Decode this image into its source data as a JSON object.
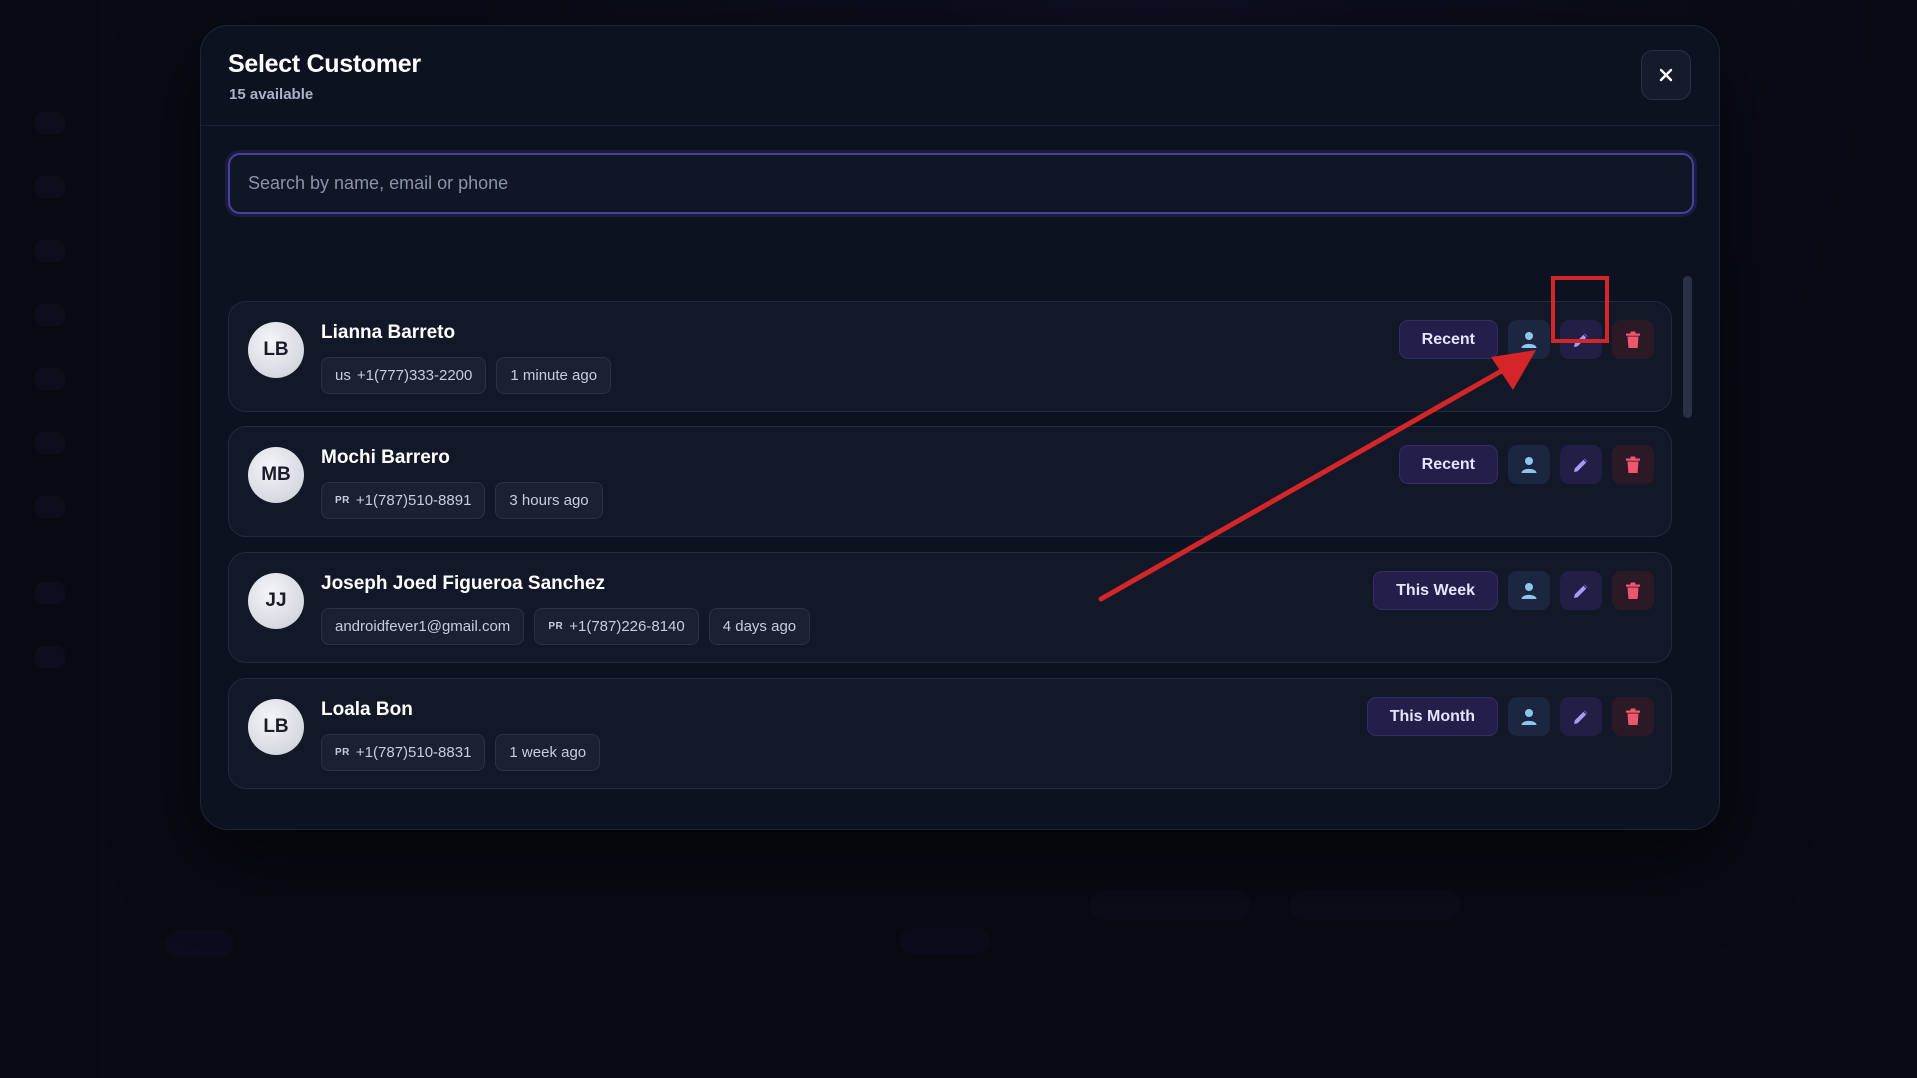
{
  "modal": {
    "title": "Select Customer",
    "subtitle": "15 available",
    "close_glyph": "✕"
  },
  "search": {
    "placeholder": "Search by name, email or phone",
    "value": ""
  },
  "customers": [
    {
      "initials": "LB",
      "name": "Lianna Barreto",
      "chips": [
        {
          "country": "us",
          "phone": "+1(777)333-2200"
        },
        {
          "text": "1 minute ago"
        }
      ],
      "badge": "Recent"
    },
    {
      "initials": "MB",
      "name": "Mochi Barrero",
      "chips": [
        {
          "country": "PR",
          "phone": "+1(787)510-8891"
        },
        {
          "text": "3 hours ago"
        }
      ],
      "badge": "Recent"
    },
    {
      "initials": "JJ",
      "name": "Joseph Joed Figueroa Sanchez",
      "chips": [
        {
          "text": "androidfever1@gmail.com"
        },
        {
          "country": "PR",
          "phone": "+1(787)226-8140"
        },
        {
          "text": "4 days ago"
        }
      ],
      "badge": "This Week"
    },
    {
      "initials": "LB",
      "name": "Loala Bon",
      "chips": [
        {
          "country": "PR",
          "phone": "+1(787)510-8831"
        },
        {
          "text": "1 week ago"
        }
      ],
      "badge": "This Month"
    },
    {
      "initials": "",
      "name": "",
      "chips": [],
      "badge": ""
    }
  ],
  "icons": {
    "profile": "person-icon",
    "edit": "pencil-icon",
    "delete": "trash-icon",
    "close": "close-icon"
  },
  "colors": {
    "accent": "#8b7cf6",
    "profile_icon": "#8fc4ee",
    "delete_icon": "#f0566e",
    "annotation": "#d42628"
  }
}
